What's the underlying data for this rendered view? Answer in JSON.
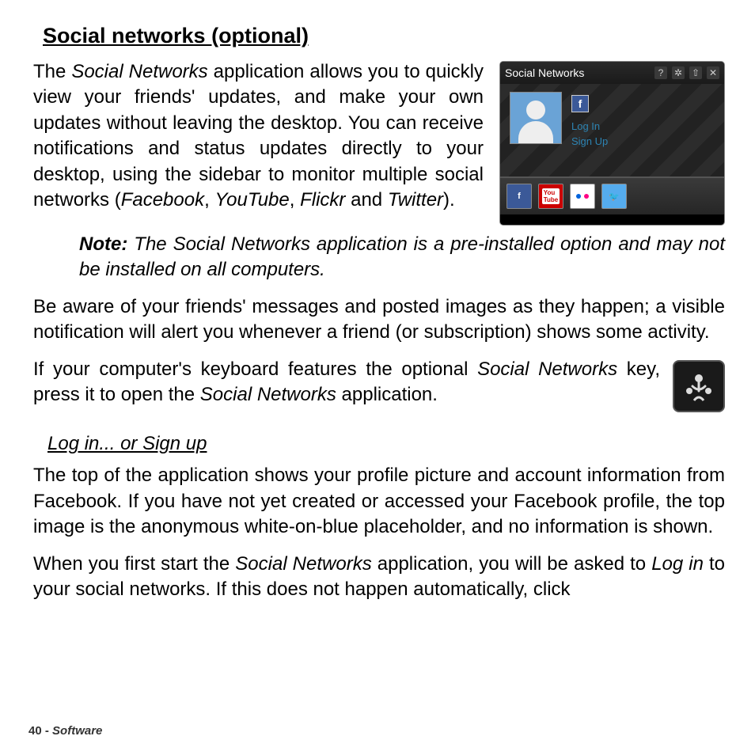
{
  "section_title": "Social networks (optional)",
  "paragraphs": {
    "intro_html": "The <em>Social Networks</em> application allows you to quickly view your friends' updates, and make your own updates without leaving the desktop. You can receive notifications and status updates directly to your desktop, using the sidebar to monitor multiple social networks (<em>Facebook</em>, <em>YouTube</em>, <em>Flickr</em> and <em>Twitter</em>).",
    "note_label": "Note:",
    "note_body": " The Social Networks application is a pre-installed option and may not be installed on all computers.",
    "p2": "Be aware of your friends' messages and posted images as they happen; a visible notification will alert you whenever a friend (or subscription) shows some activity.",
    "p3_html": "If your computer's keyboard features the optional <em>Social Networks</em> key, press it to open the <em>Social Networks</em> application.",
    "sub_title": "Log in... or Sign up",
    "p4": "The top of the application shows your profile picture and account information from Facebook. If you have not yet created or accessed your Facebook profile, the top image is the anonymous white-on-blue placeholder, and no information is shown.",
    "p5_html": "When you first start the <em>Social Networks</em> application, you will be asked to <em>Log in</em> to your social networks. If this does not happen automatically, click"
  },
  "widget": {
    "title": "Social Networks",
    "login_label": "Log In",
    "signup_label": "Sign Up",
    "toolbar_icons": [
      "?",
      "✲",
      "⇧",
      "✕"
    ],
    "services": [
      "facebook",
      "youtube",
      "flickr",
      "twitter"
    ]
  },
  "footer": {
    "page_number": "40",
    "separator": " - ",
    "section": "Software"
  }
}
